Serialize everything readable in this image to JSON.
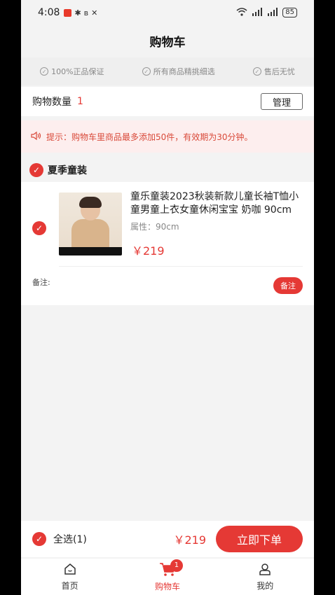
{
  "status": {
    "time": "4:08",
    "signal_a": "⁴ᴳ",
    "signal_b": "⁴ᴳ",
    "battery": "85"
  },
  "header": {
    "title": "购物车"
  },
  "guarantees": [
    {
      "label": "100%正品保证"
    },
    {
      "label": "所有商品精挑细选"
    },
    {
      "label": "售后无忧"
    }
  ],
  "cart": {
    "count_label": "购物数量",
    "count": "1",
    "manage_label": "管理"
  },
  "tip": {
    "text": "提示：购物车里商品最多添加50件，有效期为30分钟。"
  },
  "shop": {
    "name": "夏季童装",
    "item": {
      "title": "童乐童装2023秋装新款儿童长袖T恤小童男童上衣女童休闲宝宝 奶咖 90cm",
      "attribute": "属性：90cm",
      "price": "￥219",
      "remark_label": "备注:",
      "remark_button": "备注"
    }
  },
  "checkout": {
    "select_all": "全选(1)",
    "total": "￥219",
    "order_button": "立即下单"
  },
  "tabs": [
    {
      "label": "首页",
      "icon": "home-icon"
    },
    {
      "label": "购物车",
      "icon": "cart-icon",
      "badge": "1"
    },
    {
      "label": "我的",
      "icon": "user-icon"
    }
  ],
  "colors": {
    "accent": "#e53935",
    "tip_bg": "#fdeeee"
  }
}
